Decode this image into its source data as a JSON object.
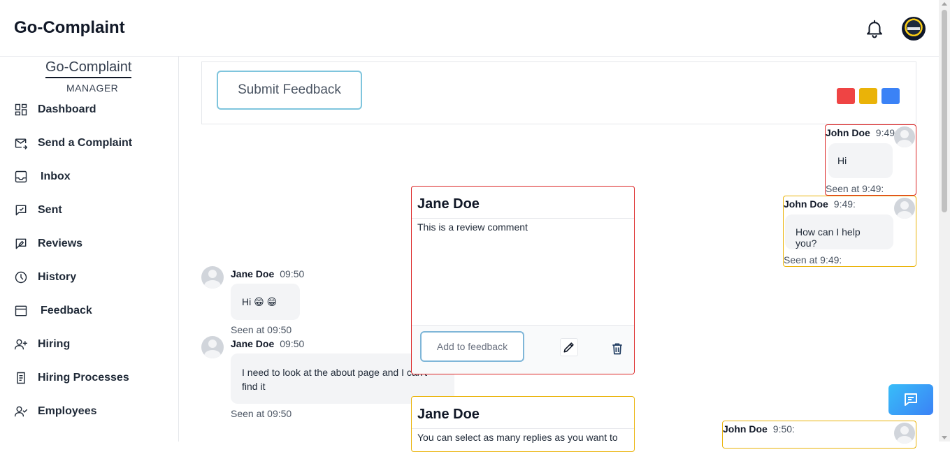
{
  "header": {
    "title": "Go-Complaint"
  },
  "sidebar": {
    "brand": "Go-Complaint",
    "role": "MANAGER",
    "items": [
      {
        "label": "Dashboard",
        "icon": "dashboard-icon"
      },
      {
        "label": "Send a Complaint",
        "icon": "send-mail-icon"
      },
      {
        "label": "Inbox",
        "icon": "inbox-icon"
      },
      {
        "label": "Sent",
        "icon": "sent-icon"
      },
      {
        "label": "Reviews",
        "icon": "reviews-icon"
      },
      {
        "label": "History",
        "icon": "clock-icon"
      },
      {
        "label": "Feedback",
        "icon": "feedback-icon"
      },
      {
        "label": "Hiring",
        "icon": "user-plus-icon"
      },
      {
        "label": "Hiring Processes",
        "icon": "document-icon"
      },
      {
        "label": "Employees",
        "icon": "user-check-icon"
      }
    ]
  },
  "feedback": {
    "submit_label": "Submit Feedback",
    "colors": [
      "#ef4444",
      "#eab308",
      "#3b82f6"
    ]
  },
  "right_messages": [
    {
      "name": "John Doe",
      "time": "9:49:",
      "text": "Hi",
      "seen": "Seen at 9:49:",
      "border": "#dc2626"
    },
    {
      "name": "John Doe",
      "time": "9:49:",
      "text": "How can I help you?",
      "seen": "Seen at 9:49:",
      "border": "#eab308"
    },
    {
      "name": "John Doe",
      "time": "9:50:",
      "border": "#eab308"
    }
  ],
  "left_messages": [
    {
      "name": "Jane Doe",
      "time": "09:50",
      "text": "Hi 😁 😁",
      "seen": "Seen at 09:50"
    },
    {
      "name": "Jane Doe",
      "time": "09:50",
      "text": "I need to look at the about page and I can't find it",
      "seen": "Seen at 09:50"
    }
  ],
  "reviews": [
    {
      "author": "Jane Doe",
      "comment": "This is a review comment",
      "add_label": "Add to feedback",
      "border": "#dc2626"
    },
    {
      "author": "Jane Doe",
      "comment": "You can select as many replies as you want to",
      "border": "#eab308"
    }
  ]
}
